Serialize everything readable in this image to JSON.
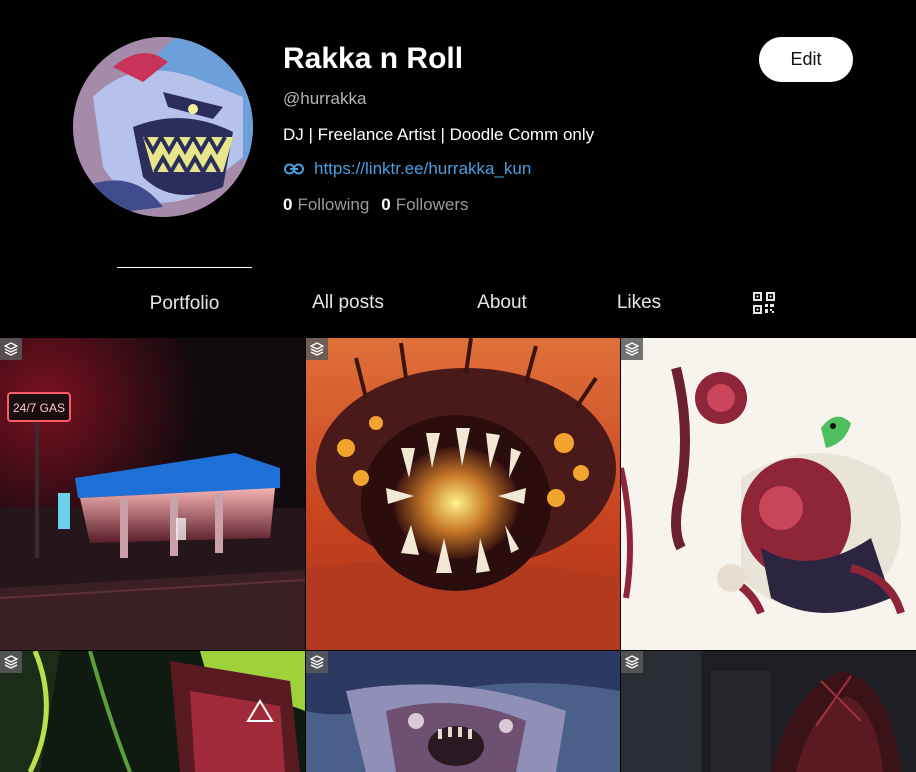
{
  "profile": {
    "name": "Rakka n Roll",
    "handle": "@hurrakka",
    "bio": "DJ | Freelance Artist | Doodle Comm only",
    "link": "https://linktr.ee/hurrakka_kun",
    "following_count": "0",
    "following_label": "Following",
    "followers_count": "0",
    "followers_label": "Followers",
    "edit_label": "Edit"
  },
  "tabs": [
    {
      "label": "Portfolio",
      "active": true
    },
    {
      "label": "All posts",
      "active": false
    },
    {
      "label": "About",
      "active": false
    },
    {
      "label": "Likes",
      "active": false
    }
  ],
  "qr_icon": "qr-code-icon",
  "gallery": {
    "layers_icon": "layers-icon",
    "items": [
      {
        "sign_text": "24/7 GAS"
      },
      {},
      {},
      {},
      {},
      {}
    ]
  },
  "colors": {
    "background": "#000000",
    "link": "#4a9fe0",
    "muted_text": "#9a9a9a"
  }
}
